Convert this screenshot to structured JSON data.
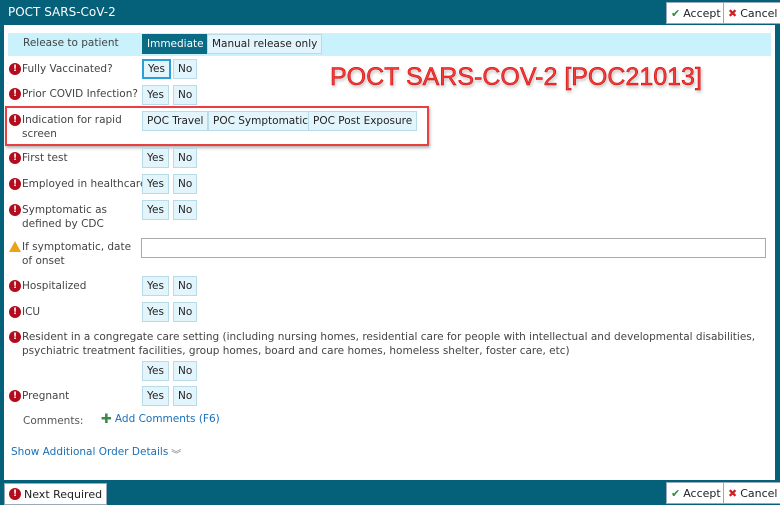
{
  "window": {
    "title": "POCT SARS-CoV-2",
    "accept": "Accept",
    "cancel": "Cancel",
    "next_required": "Next Required"
  },
  "colors": {
    "header": "#05617a",
    "required": "#b30d1d",
    "highlight": "#e84040",
    "selected": "#0b6b85"
  },
  "overlay": {
    "order_name": "POCT SARS-COV-2 [POC21013]"
  },
  "form": {
    "release": {
      "label": "Release to patient",
      "options": [
        "Immediate",
        "Manual release only"
      ],
      "selected": "Immediate"
    },
    "fully_vaccinated": {
      "label": "Fully Vaccinated?",
      "yes": "Yes",
      "no": "No"
    },
    "prior_covid": {
      "label": "Prior COVID Infection?",
      "yes": "Yes",
      "no": "No"
    },
    "indication": {
      "label": "Indication for rapid screen",
      "options": [
        "POC Travel",
        "POC Symptomatic",
        "POC Post Exposure"
      ]
    },
    "first_test": {
      "label": "First test",
      "yes": "Yes",
      "no": "No"
    },
    "employed_healthcare": {
      "label": "Employed in healthcare",
      "yes": "Yes",
      "no": "No"
    },
    "symptomatic_cdc": {
      "label": "Symptomatic as defined by CDC",
      "yes": "Yes",
      "no": "No"
    },
    "onset_date": {
      "label": "If symptomatic, date of onset",
      "value": ""
    },
    "hospitalized": {
      "label": "Hospitalized",
      "yes": "Yes",
      "no": "No"
    },
    "icu": {
      "label": "ICU",
      "yes": "Yes",
      "no": "No"
    },
    "congregate": {
      "label": "Resident in a congregate care setting (including nursing homes, residential care for people with intellectual and developmental disabilities, psychiatric treatment facilities, group homes, board and care homes, homeless shelter, foster care, etc)",
      "yes": "Yes",
      "no": "No"
    },
    "pregnant": {
      "label": "Pregnant",
      "yes": "Yes",
      "no": "No"
    },
    "comments": {
      "label": "Comments:",
      "add": "Add Comments (F6)"
    },
    "show_details": "Show Additional Order Details"
  }
}
